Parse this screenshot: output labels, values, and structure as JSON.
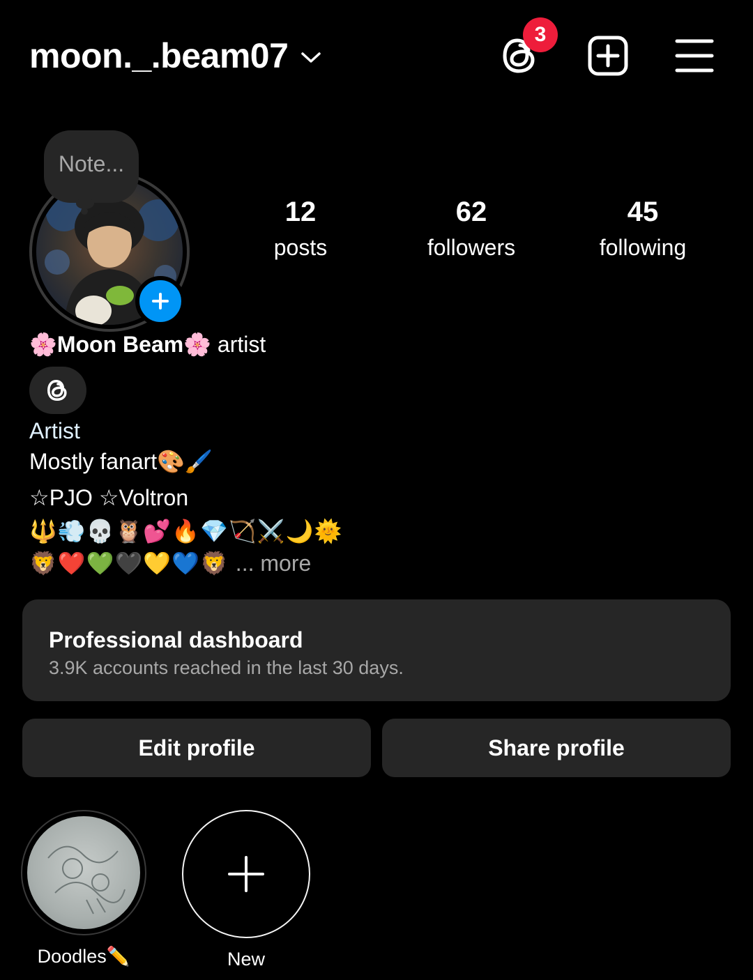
{
  "header": {
    "username": "moon._.beam07",
    "threads_badge_count": "3",
    "icons": [
      "chevron-down-icon",
      "threads-icon",
      "create-plus-square-icon",
      "hamburger-menu-icon"
    ]
  },
  "profile": {
    "note_placeholder": "Note...",
    "stats": [
      {
        "value": "12",
        "label": "posts"
      },
      {
        "value": "62",
        "label": "followers"
      },
      {
        "value": "45",
        "label": "following"
      }
    ],
    "display_name": "🌸Moon Beam🌸",
    "display_category": "artist",
    "category": "Artist",
    "bio_lines": [
      "Mostly fanart🎨🖌️",
      "☆PJO ☆Voltron",
      "🔱💨💀🦉💕🔥💎🏹⚔️🌙🌞",
      "🦁❤️💚🖤💛💙🦁"
    ],
    "more_label": "... more"
  },
  "dashboard": {
    "title": "Professional dashboard",
    "subtitle": "3.9K accounts reached in the last 30 days."
  },
  "buttons": {
    "edit": "Edit profile",
    "share": "Share profile"
  },
  "highlights": [
    {
      "label": "Doodles✏️"
    },
    {
      "label": "New"
    }
  ],
  "colors": {
    "background": "#000000",
    "surface": "#262626",
    "accent_blue": "#0095f6",
    "badge_red": "#ee1d3b",
    "muted_text": "#a8a8a8"
  }
}
